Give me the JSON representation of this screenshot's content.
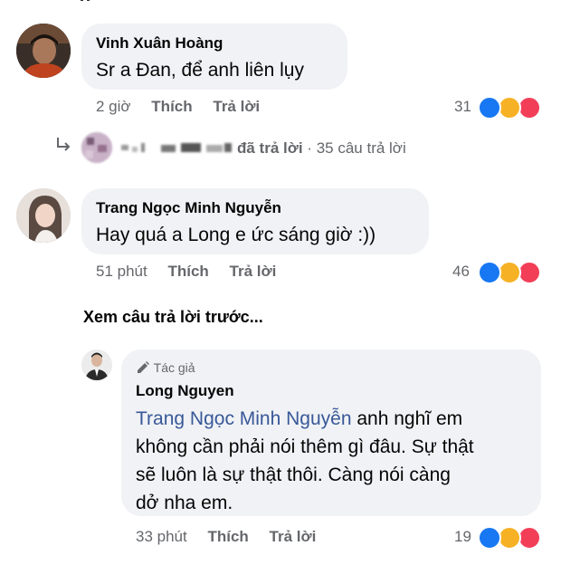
{
  "comment1": {
    "author": "Vinh Xuân Hoàng",
    "text": "Sr a Đan, để anh liên lụy",
    "time": "2 giờ",
    "like_label": "Thích",
    "reply_label": "Trả lời",
    "reaction_count": "31"
  },
  "replies_summary": {
    "blurred_names": "",
    "replied_text": "đã trả lời",
    "separator": "·",
    "reply_count_text": "35 câu trả lời"
  },
  "comment2": {
    "author": "Trang Ngọc Minh Nguyễn",
    "text": "Hay quá a Long e ức sáng giờ :))",
    "time": "51 phút",
    "like_label": "Thích",
    "reply_label": "Trả lời",
    "reaction_count": "46"
  },
  "view_previous": "Xem câu trả lời trước...",
  "reply": {
    "badge": "Tác giả",
    "author": "Long Nguyen",
    "mention": "Trang Ngọc Minh Nguyễn",
    "line1": "anh nghĩ em",
    "line2": "không cần phải nói thêm gì đâu. Sự thật",
    "line3": "sẽ luôn là sự thật thôi. Càng nói càng",
    "line4": "dở nha em.",
    "time": "33 phút",
    "like_label": "Thích",
    "reply_label": "Trả lời",
    "reaction_count": "19"
  },
  "colors": {
    "like": "#1877f2",
    "haha": "#f7b125",
    "love": "#f33e58",
    "bubble": "#f0f2f5",
    "meta": "#65676b",
    "mention": "#385898"
  }
}
